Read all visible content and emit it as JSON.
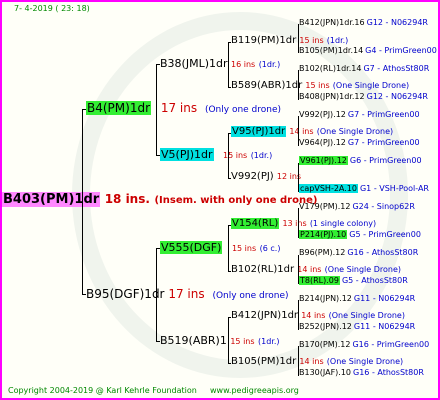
{
  "header": {
    "date": "7-  4-2019 ( 23: 18)"
  },
  "root": {
    "name": "B403(PM)1dr",
    "ins": "18 ins.",
    "note": "(Insem. with only one drone)"
  },
  "gen1": [
    {
      "name": "B4(PM)1dr",
      "ins": "17 ins",
      "note": "(Only one drone)"
    },
    {
      "name": "B95(DGF)1dr",
      "ins": "17 ins",
      "note": "(Only one drone)"
    }
  ],
  "gen2": [
    {
      "name": "B38(JML)1dr",
      "ins": "16 ins",
      "note": "(1dr.)"
    },
    {
      "name": "V5(PJ)1dr",
      "ins": "15 ins",
      "note": "(1dr.)"
    },
    {
      "name": "V555(DGF)",
      "ins": "15 ins",
      "note": "(6 c.)"
    },
    {
      "name": "B519(ABR)1",
      "ins": "15 ins",
      "note": "(1dr.)"
    }
  ],
  "gen3": [
    {
      "name": "B119(PM)1dr",
      "ins": "15 ins",
      "note": "(1dr.)"
    },
    {
      "name": "B589(ABR)1dr",
      "ins": "15 ins",
      "note": "(One Single Drone)"
    },
    {
      "name": "V95(PJ)1dr",
      "ins": "14 ins",
      "note": "(One Single Drone)"
    },
    {
      "name": "V992(PJ)",
      "ins": "12 ins",
      "note": ""
    },
    {
      "name": "V154(RL)",
      "ins": "13 ins",
      "note": "(1 single colony)"
    },
    {
      "name": "B102(RL)1dr",
      "ins": "14 ins",
      "note": "(One Single Drone)"
    },
    {
      "name": "B412(JPN)1dr",
      "ins": "14 ins",
      "note": "(One Single Drone)"
    },
    {
      "name": "B105(PM)1dr",
      "ins": "14 ins",
      "note": "(One Single Drone)"
    }
  ],
  "gen4": [
    {
      "name": "B412(JPN)1dr.16",
      "code": "G12 - N06294R",
      "hl": ""
    },
    {
      "name": "B105(PM)1dr.14",
      "code": "G4 - PrimGreen00",
      "hl": ""
    },
    {
      "name": "B102(RL)1dr.14",
      "code": "G7 - AthosSt80R",
      "hl": ""
    },
    {
      "name": "B408(JPN)1dr.12",
      "code": "G12 - N06294R",
      "hl": ""
    },
    {
      "name": "V992(PJ).12",
      "code": "G7 - PrimGreen00",
      "hl": ""
    },
    {
      "name": "V964(PJ).12",
      "code": "G7 - PrimGreen00",
      "hl": ""
    },
    {
      "name": "V961(PJ).12",
      "code": "G6 - PrimGreen00",
      "hl": "g"
    },
    {
      "name": "capVSH-2A.10",
      "code": "G1 - VSH-Pool-AR",
      "hl": "c"
    },
    {
      "name": "V179(PM).12",
      "code": "G24 - Sinop62R",
      "hl": ""
    },
    {
      "name": "P214(PJ).10",
      "code": "G5 - PrimGreen00",
      "hl": "g"
    },
    {
      "name": "B96(PM).12",
      "code": "G16 - AthosSt80R",
      "hl": ""
    },
    {
      "name": "T8(RL).09",
      "code": "G5 - AthosSt80R",
      "hl": "g"
    },
    {
      "name": "B214(JPN).12",
      "code": "G11 - N06294R",
      "hl": ""
    },
    {
      "name": "B252(JPN).12",
      "code": "G11 - N06294R",
      "hl": ""
    },
    {
      "name": "B170(PM).12",
      "code": "G16 - PrimGreen00",
      "hl": ""
    },
    {
      "name": "B130(JAF).10",
      "code": "G16 - AthosSt80R",
      "hl": ""
    }
  ],
  "footer": {
    "copyright": "Copyright 2004-2019 @ Karl Kehrle Foundation",
    "url": "www.pedigreeapis.org"
  }
}
